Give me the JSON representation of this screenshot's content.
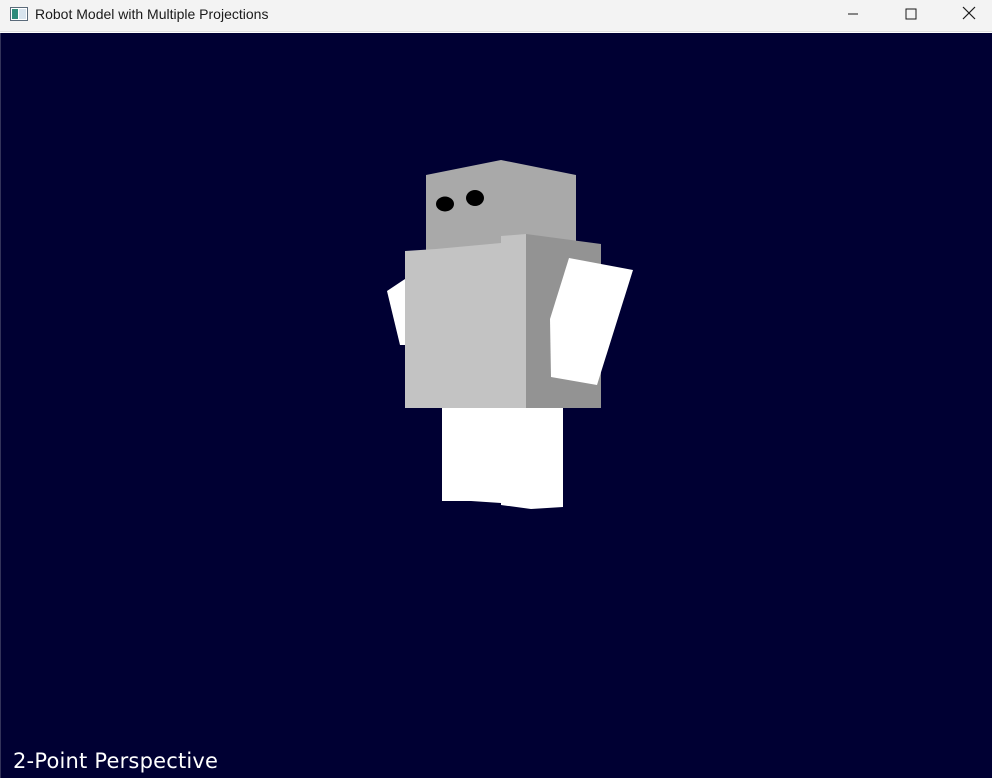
{
  "window": {
    "title": "Robot Model with Multiple Projections",
    "controls": {
      "minimize_icon": "minimize-icon",
      "maximize_icon": "maximize-icon",
      "close_icon": "close-icon"
    }
  },
  "viewport": {
    "background_color": "#000033",
    "projection_label": "2-Point Perspective"
  },
  "robot": {
    "colors": {
      "head": "#a9a9a9",
      "body_front": "#c3c3c3",
      "body_side": "#939393",
      "limbs": "#ffffff",
      "eyes": "#000000"
    }
  }
}
